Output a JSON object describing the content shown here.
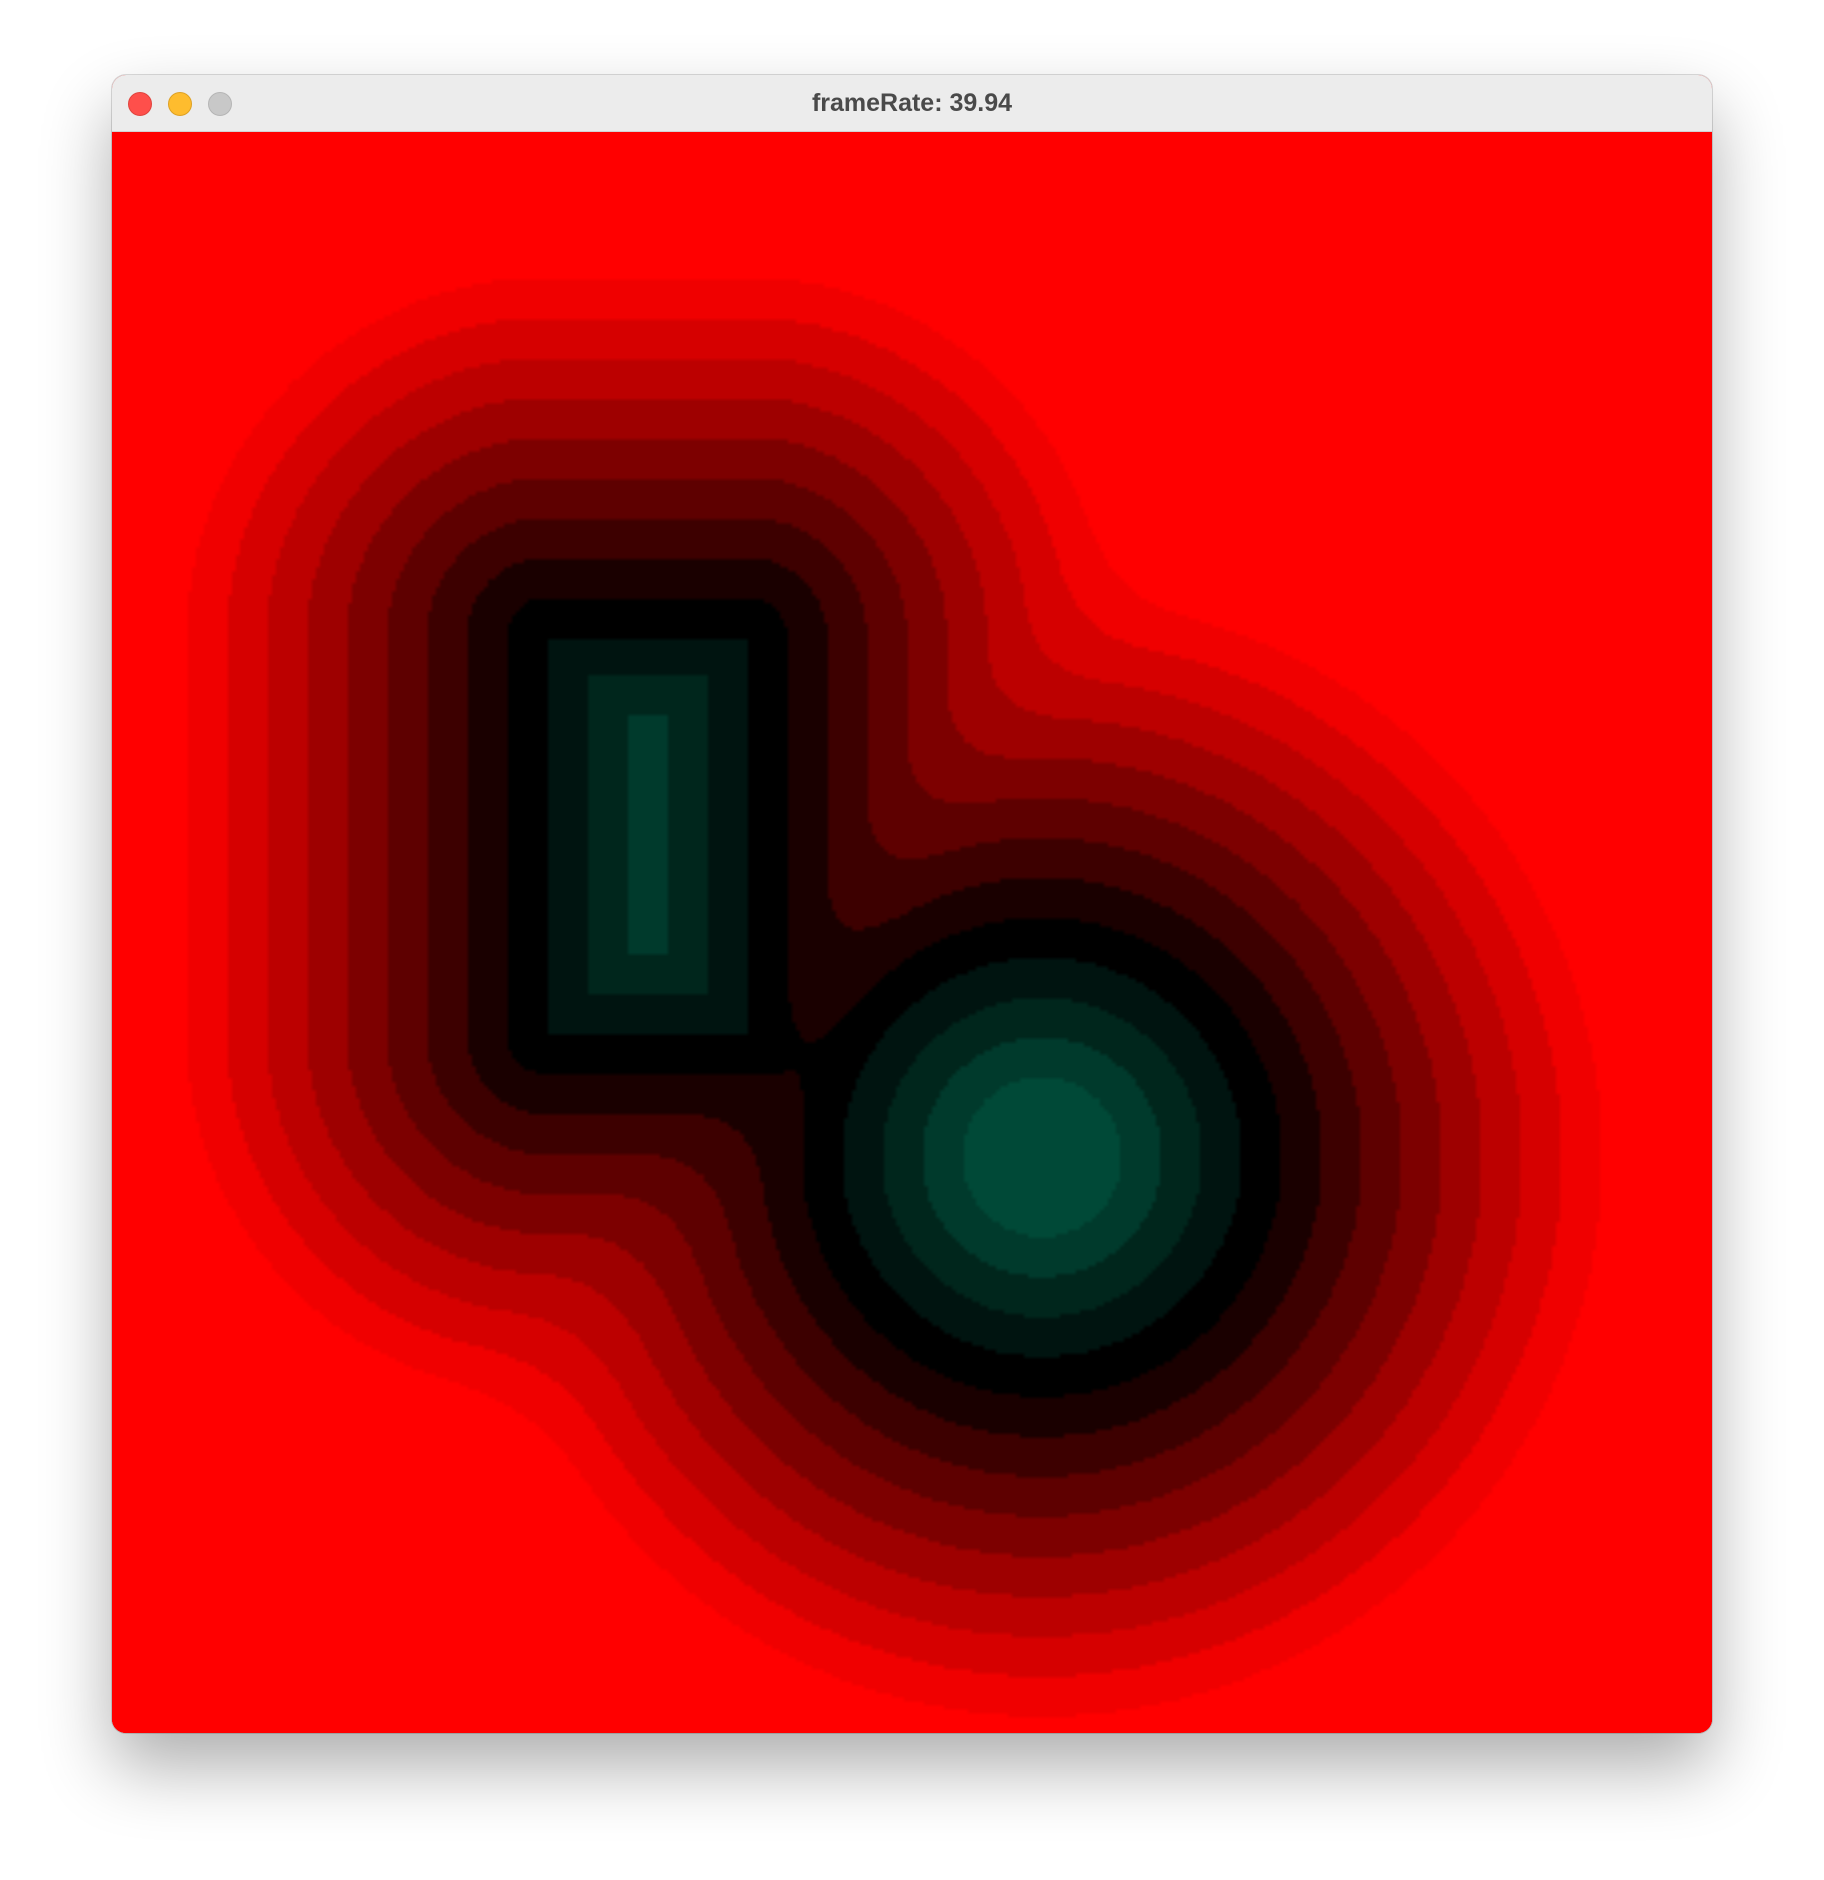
{
  "window": {
    "title": "frameRate: 39.94",
    "buttons": {
      "close": "close-button",
      "minimize": "minimize-button",
      "zoom": "zoom-button"
    }
  },
  "sketch": {
    "background": "#ff0000",
    "contour_colors": [
      "#ff0000",
      "#f00000",
      "#d60000",
      "#bc0000",
      "#9e0000",
      "#7d0000",
      "#5e0000",
      "#3d0000",
      "#1a0000",
      "#000000",
      "#001410",
      "#00261c",
      "#003a2c",
      "#004937"
    ]
  }
}
